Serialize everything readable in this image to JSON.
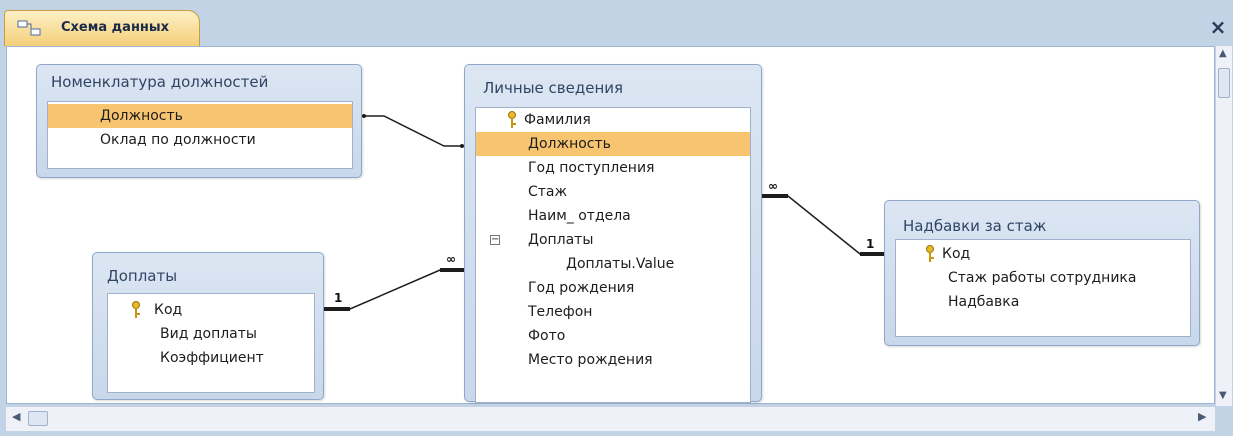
{
  "document_tab": {
    "label": "Схема данных",
    "icon": "relationships-icon"
  },
  "window": {
    "close_label": "×"
  },
  "tables": {
    "nomenclature": {
      "title": "Номенклатура должностей",
      "fields": [
        "Должность",
        "Оклад по должности"
      ],
      "selected_index": 0
    },
    "personal": {
      "title": "Личные сведения",
      "fields": [
        "Фамилия",
        "Должность",
        "Год поступления",
        "Стаж",
        "Наим_ отдела",
        "Доплаты",
        "Доплаты.Value",
        "Год рождения",
        "Телефон",
        "Фото",
        "Место рождения"
      ],
      "key_index": 0,
      "selected_index": 1
    },
    "payments": {
      "title": "Доплаты",
      "fields": [
        "Код",
        "Вид доплаты",
        "Коэффициент"
      ],
      "key_index": 0
    },
    "bonuses": {
      "title": "Надбавки за стаж",
      "fields": [
        "Код",
        "Стаж работы сотрудника",
        "Надбавка"
      ],
      "key_index": 0
    }
  },
  "relationships": [
    {
      "from": "Номенклатура должностей.Должность",
      "to": "Личные сведения.Должность",
      "one_label": "",
      "many_label": ""
    },
    {
      "from": "Доплаты.Код",
      "to": "Личные сведения.Доплаты",
      "one_label": "1",
      "many_label": "∞"
    },
    {
      "from": "Надбавки за стаж.Код",
      "to": "Личные сведения.Стаж",
      "one_label": "1",
      "many_label": "∞"
    }
  ],
  "colors": {
    "selected_field": "#f7c46f",
    "tab_bg": "#f4cf79",
    "frame_bg": "#c3d3e6"
  }
}
